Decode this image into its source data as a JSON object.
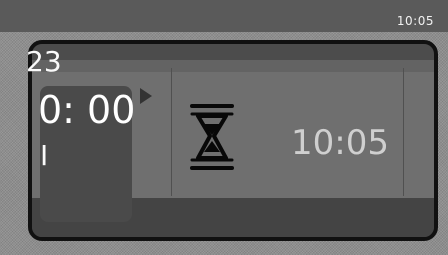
{
  "status_bar": {
    "time": "10:05"
  },
  "start_card": {
    "top_value": "23",
    "middle_value": "0: 00",
    "bottom_value": "I"
  },
  "center": {
    "icon": "hourglass-icon"
  },
  "end_card": {
    "time": "10:05"
  },
  "colors": {
    "background": "#8e8e8e",
    "frame": "#4c4c4c",
    "frame_border": "#111111",
    "active_text": "#ffffff",
    "muted_text": "#cfcfcf"
  }
}
